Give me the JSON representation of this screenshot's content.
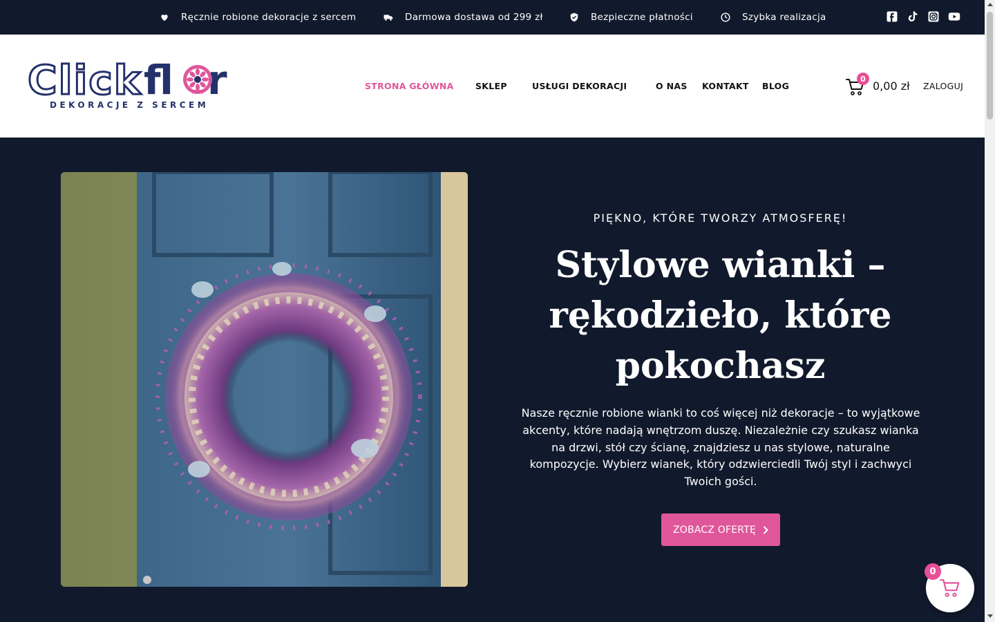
{
  "topbar": {
    "items": [
      {
        "icon": "heart-icon",
        "label": "Ręcznie robione dekoracje z sercem"
      },
      {
        "icon": "truck-icon",
        "label": "Darmowa dostawa od 299 zł"
      },
      {
        "icon": "shield-check-icon",
        "label": "Bezpieczne płatności"
      },
      {
        "icon": "clock-icon",
        "label": "Szybka realizacja"
      }
    ],
    "social": [
      "facebook-icon",
      "tiktok-icon",
      "instagram-icon",
      "youtube-icon"
    ]
  },
  "header": {
    "logo": {
      "word1": "Click",
      "word2": "fl",
      "word3": "r",
      "tagline": "DEKORACJE Z SERCEM"
    },
    "nav": [
      {
        "label": "STRONA GŁÓWNA",
        "active": true
      },
      {
        "label": "SKLEP",
        "active": false
      },
      {
        "label": "USŁUGI DEKORACJI",
        "active": false
      },
      {
        "label": "O NAS",
        "active": false
      },
      {
        "label": "KONTAKT",
        "active": false
      },
      {
        "label": "BLOG",
        "active": false
      }
    ],
    "cart": {
      "count": "0",
      "total": "0,00 zł"
    },
    "login": "ZALOGUJ"
  },
  "hero": {
    "eyebrow": "PIĘKNO, KTÓRE TWORZY ATMOSFERĘ!",
    "title": "Stylowe wianki – rękodzieło, które pokochasz",
    "description": "Nasze ręcznie robione wianki to coś więcej niż dekoracje – to wyjątkowe akcenty, które nadają wnętrzom duszę. Niezależnie czy szukasz wianka na drzwi, stół czy ścianę, znajdziesz u nas stylowe, naturalne kompozycje. Wybierz wianek, który odzwierciedli Twój styl i zachwyci Twoich gości.",
    "cta": "ZOBACZ OFERTĘ"
  },
  "floating_cart": {
    "count": "0"
  },
  "colors": {
    "accent": "#e0569b",
    "navy": "#111a2c",
    "logo": "#24316a"
  }
}
